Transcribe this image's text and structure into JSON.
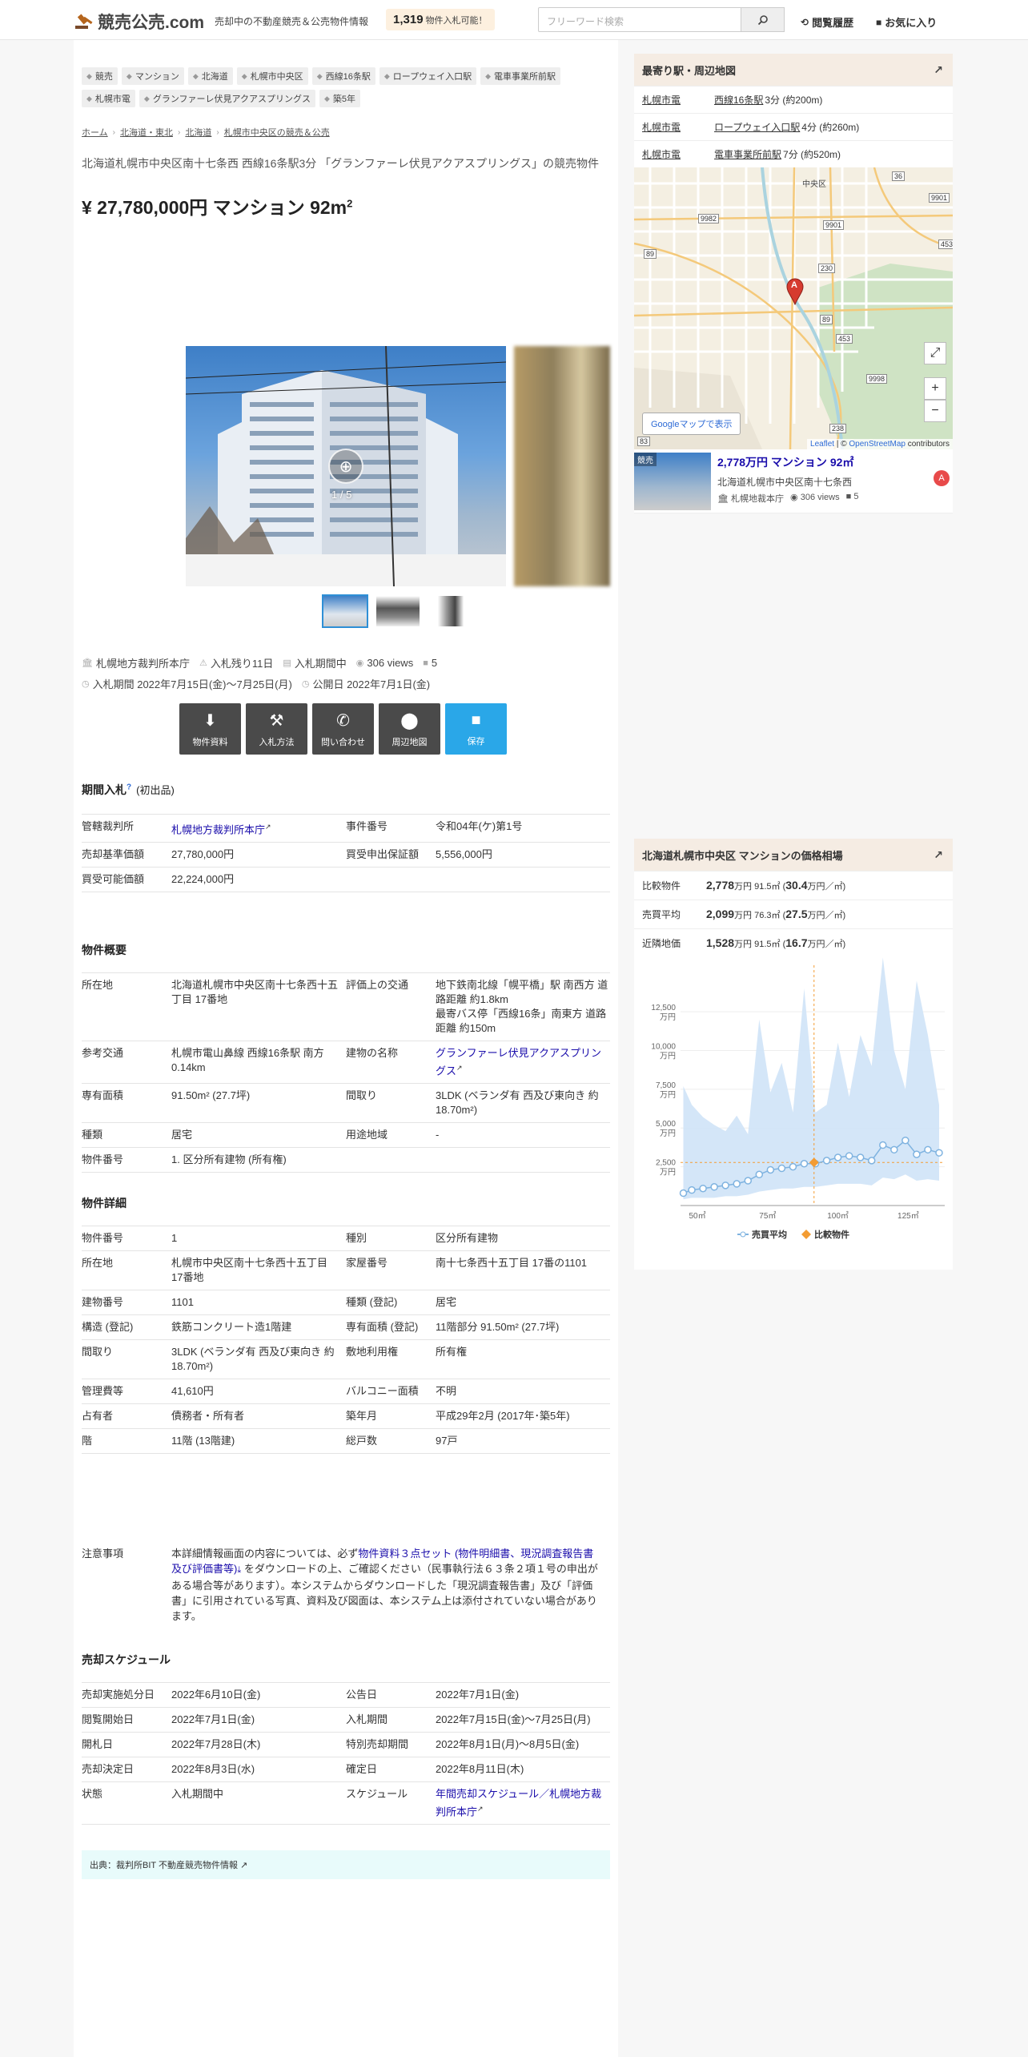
{
  "header": {
    "logo": "競売公売.com",
    "tagline": "売却中の不動産競売＆公売物件情報",
    "bid_count": "1,319",
    "bid_label": "物件入札可能！",
    "search_placeholder": "フリーワード検索",
    "history_label": "閲覧履歴",
    "favorites_label": "お気に入り"
  },
  "tags": [
    "競売",
    "マンション",
    "北海道",
    "札幌市中央区",
    "西線16条駅",
    "ロープウェイ入口駅",
    "電車事業所前駅",
    "札幌市電",
    "グランファーレ伏見アクアスプリングス",
    "築5年"
  ],
  "breadcrumbs": [
    "ホーム",
    "北海道・東北",
    "北海道",
    "札幌市中央区の競売＆公売"
  ],
  "subtitle": "北海道札幌市中央区南十七条西 西線16条駅3分 「グランファーレ伏見アクアスプリングス」の競売物件",
  "price_title": "¥ 27,780,000円 マンション 92m",
  "price_title_sup": "2",
  "photo_counter": "1 / 5",
  "meta": {
    "court": "札幌地方裁判所本庁",
    "days_left": "入札残り11日",
    "status": "入札期間中",
    "views": "306 views",
    "folders": "5",
    "bid_period": "入札期間 2022年7月15日(金)〜7月25日(月)",
    "public_date": "公開日 2022年7月1日(金)"
  },
  "actions": [
    "物件資料",
    "入札方法",
    "問い合わせ",
    "周辺地図",
    "保存"
  ],
  "section_bid": {
    "title": "期間入札",
    "help": "?",
    "sub": "(初出品)"
  },
  "bid_table": [
    [
      "管轄裁判所",
      "札幌地方裁判所本庁",
      "事件番号",
      "令和04年(ケ)第1号"
    ],
    [
      "売却基準価額",
      "27,780,000円",
      "買受申出保証額",
      "5,556,000円"
    ],
    [
      "買受可能価額",
      "22,224,000円",
      "",
      ""
    ]
  ],
  "section_overview": "物件概要",
  "overview_table": [
    [
      "所在地",
      "北海道札幌市中央区南十七条西十五丁目 17番地",
      "評価上の交通",
      "地下鉄南北線「幌平橋」駅 南西方 道路距離 約1.8km\n最寄バス停「西線16条」南東方 道路距離 約150m"
    ],
    [
      "参考交通",
      "札幌市電山鼻線 西線16条駅 南方 0.14km",
      "建物の名称",
      "グランファーレ伏見アクアスプリングス"
    ],
    [
      "専有面積",
      "91.50m² (27.7坪)",
      "間取り",
      "3LDK (ベランダ有 西及び東向き 約18.70m²)"
    ],
    [
      "種類",
      "居宅",
      "用途地域",
      "-"
    ],
    [
      "物件番号",
      "1. 区分所有建物 (所有権)",
      "",
      ""
    ]
  ],
  "section_detail": "物件詳細",
  "detail_table": [
    [
      "物件番号",
      "1",
      "種別",
      "区分所有建物"
    ],
    [
      "所在地",
      "札幌市中央区南十七条西十五丁目 17番地",
      "家屋番号",
      "南十七条西十五丁目 17番の1101"
    ],
    [
      "建物番号",
      "1101",
      "種類 (登記)",
      "居宅"
    ],
    [
      "構造 (登記)",
      "鉄筋コンクリート造1階建",
      "専有面積 (登記)",
      "11階部分 91.50m² (27.7坪)"
    ],
    [
      "間取り",
      "3LDK (ベランダ有 西及び東向き 約18.70m²)",
      "敷地利用権",
      "所有権"
    ],
    [
      "管理費等",
      "41,610円",
      "バルコニー面積",
      "不明"
    ],
    [
      "占有者",
      "債務者・所有者",
      "築年月",
      "平成29年2月 (2017年･築5年)"
    ],
    [
      "階",
      "11階 (13階建)",
      "総戸数",
      "97戸"
    ]
  ],
  "notice": {
    "key": "注意事項",
    "pre": "本詳細情報画面の内容については、必ず",
    "link": "物件資料３点セット (物件明細書、現況調査報告書及び評価書等)",
    "post": " をダウンロードの上、ご確認ください（民事執行法６３条２項１号の申出がある場合等があります）。本システムからダウンロードした「現況調査報告書」及び「評価書」に引用されている写真、資料及び図面は、本システム上は添付されていない場合があります。"
  },
  "section_schedule": "売却スケジュール",
  "schedule_table": [
    [
      "売却実施処分日",
      "2022年6月10日(金)",
      "公告日",
      "2022年7月1日(金)"
    ],
    [
      "閲覧開始日",
      "2022年7月1日(金)",
      "入札期間",
      "2022年7月15日(金)〜7月25日(月)"
    ],
    [
      "開札日",
      "2022年7月28日(木)",
      "特別売却期間",
      "2022年8月1日(月)〜8月5日(金)"
    ],
    [
      "売却決定日",
      "2022年8月3日(水)",
      "確定日",
      "2022年8月11日(木)"
    ],
    [
      "状態",
      "入札期間中",
      "スケジュール",
      "年間売却スケジュール／札幌地方裁判所本庁"
    ]
  ],
  "source": "出典：裁判所BIT 不動産競売物件情報",
  "sidebar_station": {
    "title": "最寄り駅・周辺地図",
    "rows": [
      {
        "line": "札幌市電",
        "station": "西線16条駅",
        "time": "3分 (約200m)"
      },
      {
        "line": "札幌市電",
        "station": "ロープウェイ入口駅",
        "time": "4分 (約260m)"
      },
      {
        "line": "札幌市電",
        "station": "電車事業所前駅",
        "time": "7分 (約520m)"
      }
    ],
    "map_labels": [
      "中央区",
      "9901",
      "9982",
      "36",
      "9901",
      "453",
      "89",
      "230",
      "89",
      "453",
      "9998",
      "238",
      "83",
      "238"
    ],
    "marker": "A",
    "gmap_button": "Googleマップで表示",
    "attribution_leaflet": "Leaflet",
    "attribution_mid": " | © ",
    "attribution_osm": "OpenStreetMap",
    "attribution_end": " contributors"
  },
  "sidebar_listing": {
    "badge": "競売",
    "title": "2,778万円 マンション 92㎡",
    "address": "北海道札幌市中央区南十七条西",
    "court": "札幌地裁本庁",
    "views": "306 views",
    "folders": "5",
    "marker": "A"
  },
  "sidebar_price": {
    "title": "北海道札幌市中央区 マンションの価格相場",
    "rows": [
      {
        "label": "比較物件",
        "price": "2,778",
        "unit": "万円",
        "area": "91.5㎡",
        "per": "30.4",
        "per_unit": "万円／㎡"
      },
      {
        "label": "売買平均",
        "price": "2,099",
        "unit": "万円",
        "area": "76.3㎡",
        "per": "27.5",
        "per_unit": "万円／㎡"
      },
      {
        "label": "近隣地価",
        "price": "1,528",
        "unit": "万円",
        "area": "91.5㎡",
        "per": "16.7",
        "per_unit": "万円／㎡"
      }
    ],
    "legend": [
      "売買平均",
      "比較物件"
    ]
  },
  "colors": {
    "accent_blue": "#2aa7e8",
    "dark_button": "#4a4a4a",
    "link": "#1a0dab",
    "side_head": "#f5ece3",
    "chart_band": "#cfe3f7",
    "chart_line": "#7fb3e0",
    "chart_point": "#f39c33"
  },
  "chart_data": {
    "type": "area",
    "x": [
      45,
      48,
      52,
      56,
      60,
      64,
      68,
      72,
      76,
      80,
      84,
      88,
      92,
      96,
      100,
      104,
      108,
      112,
      116,
      120,
      124,
      128,
      132,
      136
    ],
    "series": [
      {
        "name": "売買平均",
        "values": [
          800,
          1000,
          1100,
          1200,
          1300,
          1400,
          1600,
          2000,
          2300,
          2400,
          2500,
          2700,
          2700,
          2900,
          3100,
          3200,
          3100,
          2900,
          3900,
          3600,
          4200,
          3300,
          3600,
          3400
        ]
      },
      {
        "name": "band_low",
        "values": [
          400,
          500,
          500,
          500,
          600,
          600,
          700,
          900,
          1000,
          1100,
          1100,
          1200,
          1200,
          1300,
          1400,
          1400,
          1400,
          1300,
          1800,
          1700,
          2000,
          1600,
          1700,
          1600
        ]
      },
      {
        "name": "band_high",
        "values": [
          7700,
          6500,
          5700,
          5200,
          4800,
          5800,
          4600,
          12000,
          7300,
          9200,
          6000,
          14000,
          6000,
          6500,
          10500,
          7000,
          11000,
          9000,
          16000,
          10000,
          7500,
          14500,
          11000,
          6500
        ]
      }
    ],
    "compare_point": {
      "x": 91.5,
      "y": 2778
    },
    "xticks": [
      "50㎡",
      "75㎡",
      "100㎡",
      "125㎡"
    ],
    "xtick_values": [
      50,
      75,
      100,
      125
    ],
    "yticks": [
      "2,500 万円",
      "5,000 万円",
      "7,500 万円",
      "10,000 万円",
      "12,500 万円"
    ],
    "ytick_values": [
      2500,
      5000,
      7500,
      10000,
      12500
    ],
    "xlim": [
      44,
      138
    ],
    "ylim": [
      0,
      15500
    ]
  }
}
